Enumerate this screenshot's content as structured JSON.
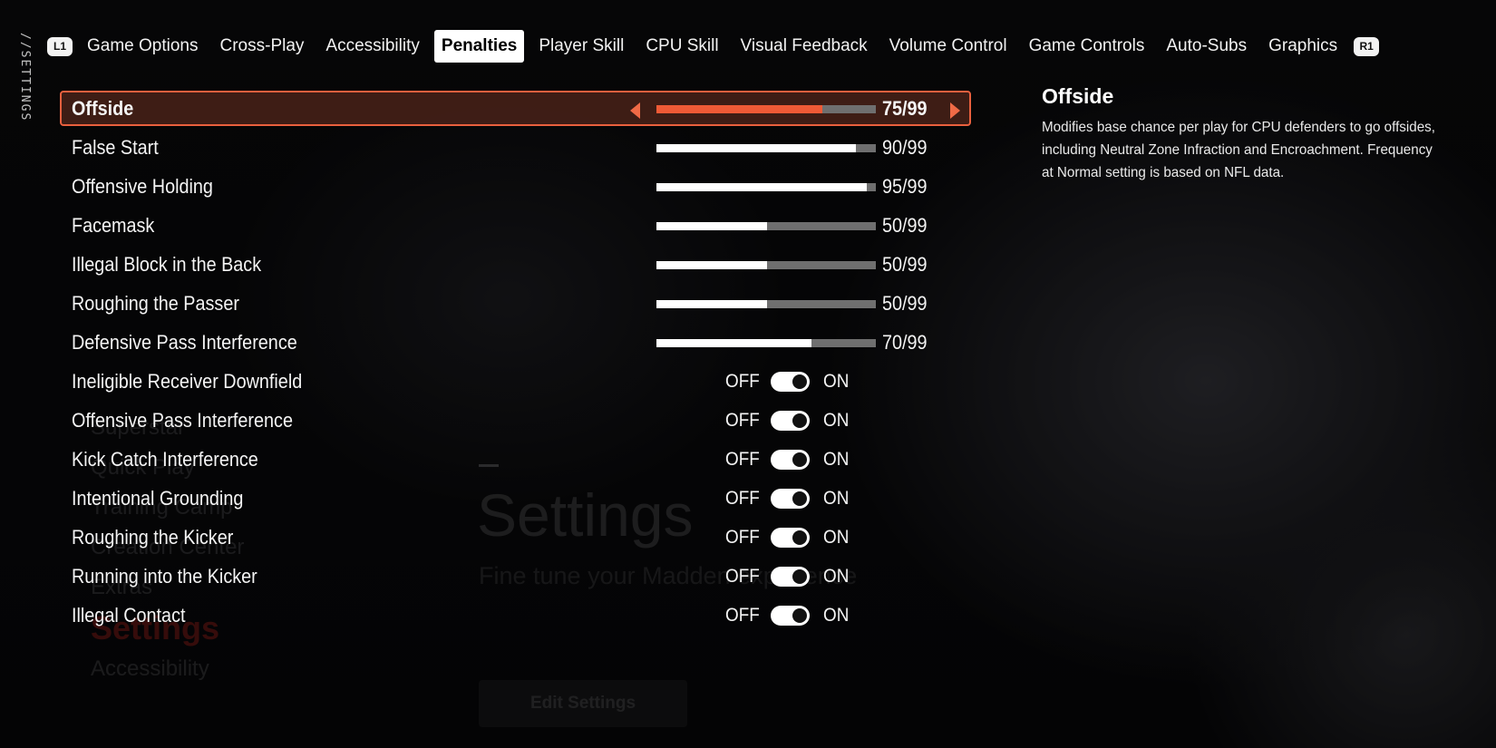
{
  "side_label": "//SETTINGS",
  "background": {
    "menu_items": [
      "Superstar",
      "Quick Play",
      "Training Camp",
      "Creation Center",
      "Extras"
    ],
    "active_item": "Settings",
    "last_item": "Accessibility",
    "title": "Settings",
    "subtitle": "Fine tune your Madden experience",
    "button": "Edit Settings"
  },
  "tabs": {
    "left_bumper": "L1",
    "right_bumper": "R1",
    "items": [
      {
        "label": "Game Options"
      },
      {
        "label": "Cross-Play"
      },
      {
        "label": "Accessibility"
      },
      {
        "label": "Penalties"
      },
      {
        "label": "Player Skill"
      },
      {
        "label": "CPU Skill"
      },
      {
        "label": "Visual Feedback"
      },
      {
        "label": "Volume Control"
      },
      {
        "label": "Game Controls"
      },
      {
        "label": "Auto-Subs"
      },
      {
        "label": "Graphics"
      }
    ],
    "active_index": 3
  },
  "settings": {
    "sliders": [
      {
        "label": "Offside",
        "value": "75/99",
        "level": 75,
        "max": 99
      },
      {
        "label": "False Start",
        "value": "90/99",
        "level": 90,
        "max": 99
      },
      {
        "label": "Offensive Holding",
        "value": "95/99",
        "level": 95,
        "max": 99
      },
      {
        "label": "Facemask",
        "value": "50/99",
        "level": 50,
        "max": 99
      },
      {
        "label": "Illegal Block in the Back",
        "value": "50/99",
        "level": 50,
        "max": 99
      },
      {
        "label": "Roughing the Passer",
        "value": "50/99",
        "level": 50,
        "max": 99
      },
      {
        "label": "Defensive Pass Interference",
        "value": "70/99",
        "level": 70,
        "max": 99
      }
    ],
    "toggle_off_label": "OFF",
    "toggle_on_label": "ON",
    "toggles": [
      {
        "label": "Ineligible Receiver Downfield",
        "on": true
      },
      {
        "label": "Offensive Pass Interference",
        "on": true
      },
      {
        "label": "Kick Catch Interference",
        "on": true
      },
      {
        "label": "Intentional Grounding",
        "on": true
      },
      {
        "label": "Roughing the Kicker",
        "on": true
      },
      {
        "label": "Running into the Kicker",
        "on": true
      },
      {
        "label": "Illegal Contact",
        "on": true
      }
    ]
  },
  "info": {
    "title": "Offside",
    "description": "Modifies base chance per play for CPU defenders to go offsides, including Neutral Zone Infraction and Encroachment. Frequency at Normal setting is based on NFL data."
  },
  "colors": {
    "accent": "#ef5a36",
    "selected_border": "#e9603e",
    "track": "#6f6f6f"
  }
}
